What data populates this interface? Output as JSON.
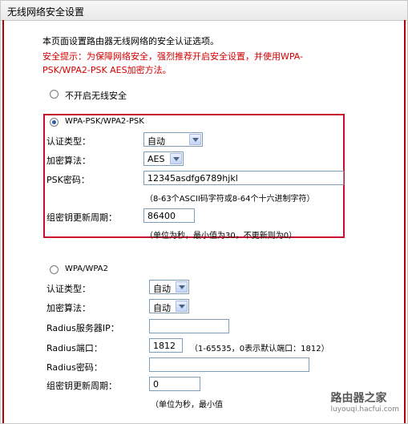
{
  "title": "无线网络安全设置",
  "intro": "本页面设置路由器无线网络的安全认证选项。",
  "warning_line1": "安全提示：为保障网络安全，强烈推荐开启安全设置，并使用WPA-",
  "warning_line2": "PSK/WPA2-PSK AES加密方法。",
  "option_disable": "不开启无线安全",
  "psk": {
    "label": "WPA-PSK/WPA2-PSK",
    "auth_label": "认证类型：",
    "auth_value": "自动",
    "enc_label": "加密算法：",
    "enc_value": "AES",
    "pwd_label": "PSK密码：",
    "pwd_value": "12345asdfg6789hjkl",
    "pwd_hint": "（8-63个ASCII码字符或8-64个十六进制字符）",
    "renew_label": "组密钥更新周期：",
    "renew_value": "86400",
    "renew_hint": "（单位为秒，最小值为30，不更新则为0）"
  },
  "wpa": {
    "label": "WPA/WPA2",
    "auth_label": "认证类型：",
    "auth_value": "自动",
    "enc_label": "加密算法：",
    "enc_value": "自动",
    "ip_label": "Radius服务器IP：",
    "ip_value": "",
    "port_label": "Radius端口：",
    "port_value": "1812",
    "port_hint": "（1-65535，0表示默认端口：1812）",
    "pwd_label": "Radius密码：",
    "pwd_value": "",
    "renew_label": "组密钥更新周期：",
    "renew_value": "0",
    "renew_hint": "（单位为秒，最小值"
  },
  "watermark": {
    "text": "路由器之家",
    "subtext": "luyouqi.hacfui.com"
  },
  "colors": {
    "warning": "#d40000",
    "highlight_border": "#c8102e",
    "side_line": "#b30000"
  }
}
